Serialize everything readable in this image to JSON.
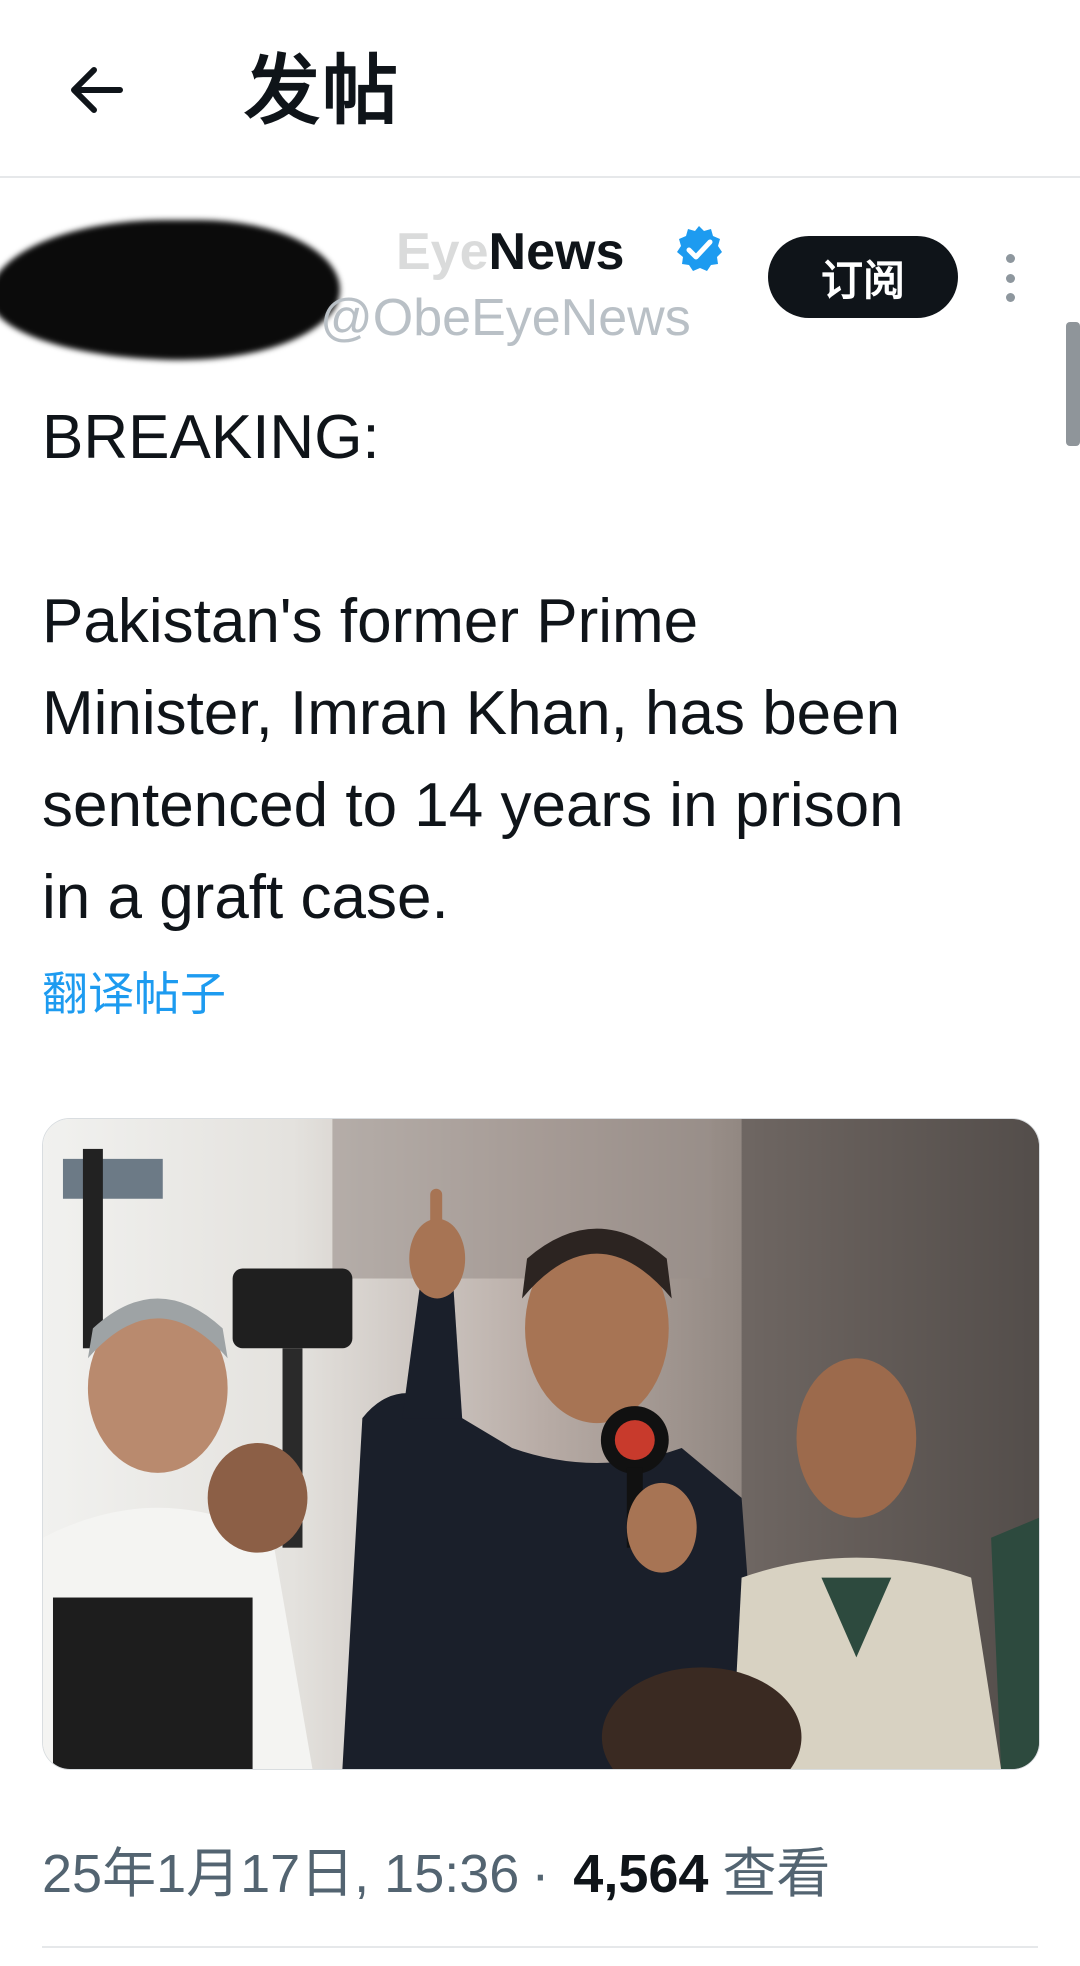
{
  "header": {
    "title": "发帖",
    "back_icon": "arrow-left-icon"
  },
  "author": {
    "name_faded": "Eye",
    "name": "News",
    "handle": "@ObeEyeNews",
    "verified_icon": "verified-badge-icon",
    "verified_color": "#1d9bf0",
    "subscribe_label": "订阅",
    "more_icon": "more-vertical-icon"
  },
  "post": {
    "heading": "BREAKING:",
    "lines": [
      "Pakistan's former Prime",
      "Minister, Imran Khan, has been",
      "sentenced to 14 years in prison",
      "in a graft case."
    ],
    "translate_label": "翻译帖子"
  },
  "meta": {
    "datetime": "25年1月17日, 15:36",
    "separator": "·",
    "views": "4,564",
    "views_label": "查看"
  },
  "colors": {
    "accent": "#1d9bf0",
    "text": "#0f1419",
    "muted": "#536471"
  }
}
